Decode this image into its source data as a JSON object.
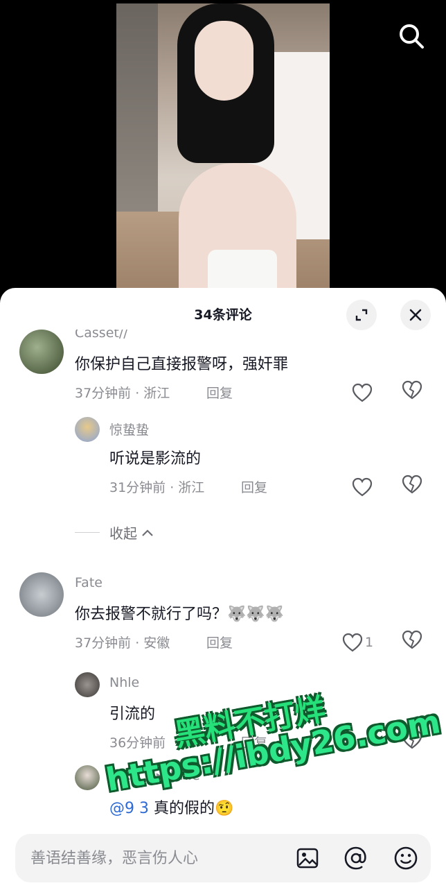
{
  "sheet": {
    "title": "34条评论"
  },
  "comments": [
    {
      "user": "Casset//",
      "text": "你保护自己直接报警呀，强奸罪",
      "time_loc": "37分钟前 · 浙江",
      "reply": "回复"
    },
    {
      "user": "惊蛰蛰",
      "text": "听说是影流的",
      "time_loc": "31分钟前 · 浙江",
      "reply": "回复"
    },
    {
      "user": "Fate",
      "text": "你去报警不就行了吗？",
      "emoji": "🐺🐺🐺",
      "time_loc": "37分钟前 · 安徽",
      "reply": "回复",
      "likes": "1"
    },
    {
      "user": "Nhle",
      "text": "引流的",
      "time_loc": "36分钟前",
      "reply": "回复"
    },
    {
      "user_partial": "C...t/ /",
      "reply_arrow": "▸",
      "reply_to": "Nhle",
      "mention": "@9 3",
      "text": " 真的假的",
      "emoji": "🤨"
    }
  ],
  "collapse_label": "收起",
  "input": {
    "placeholder": "善语结善缘，恶言伤人心"
  },
  "watermark": {
    "line1": "黑料不打烊",
    "line2": "https://ibdy26.com"
  },
  "icons": {
    "search": "search-icon",
    "expand": "expand-icon",
    "close": "close-icon",
    "like": "heart-icon",
    "dislike": "broken-heart-icon",
    "image": "image-icon",
    "at": "at-icon",
    "emoji": "emoji-icon"
  }
}
